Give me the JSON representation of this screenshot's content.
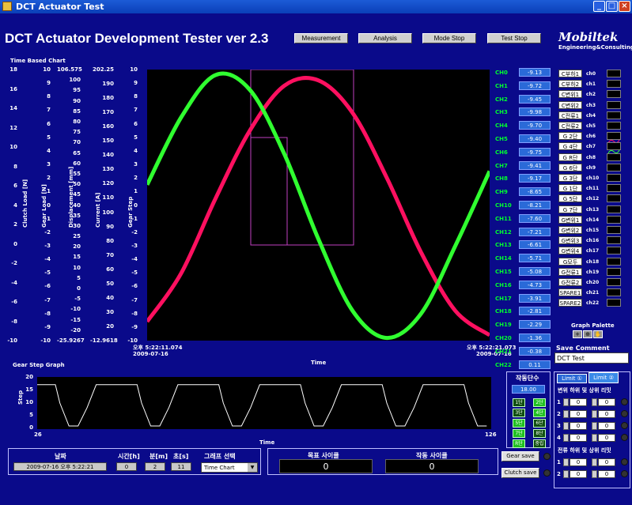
{
  "window": {
    "title": "DCT Actuator Test"
  },
  "header": {
    "app_title": "DCT Actuator Development Tester ver 2.3",
    "buttons": [
      "Measurement",
      "Analysis",
      "Mode Stop",
      "Test Stop"
    ],
    "logo": "Mobiltek",
    "logo_sub": "Engineering&Consulting"
  },
  "time_chart": {
    "section_label": "Time Based Chart",
    "axes": [
      {
        "name": "Clutch Load [N]",
        "ticks": [
          "18",
          "16",
          "14",
          "12",
          "10",
          "8",
          "6",
          "4",
          "2",
          "0",
          "-2",
          "-4",
          "-6",
          "-8",
          "-10"
        ]
      },
      {
        "name": "Gear Load [N]",
        "ticks": [
          "10",
          "9",
          "8",
          "7",
          "6",
          "5",
          "4",
          "3",
          "2",
          "1",
          "0",
          "-1",
          "-2",
          "-3",
          "-4",
          "-5",
          "-6",
          "-7",
          "-8",
          "-9",
          "-10"
        ]
      },
      {
        "name": "Displacement [mm]",
        "ticks": [
          "106.575",
          "100",
          "95",
          "90",
          "85",
          "80",
          "75",
          "70",
          "65",
          "60",
          "55",
          "50",
          "45",
          "40",
          "35",
          "30",
          "25",
          "20",
          "15",
          "10",
          "5",
          "0",
          "-5",
          "-10",
          "-15",
          "-20",
          "-25.9267"
        ]
      },
      {
        "name": "Current [A]",
        "ticks": [
          "202.25",
          "190",
          "180",
          "170",
          "160",
          "150",
          "140",
          "130",
          "120",
          "110",
          "100",
          "90",
          "80",
          "70",
          "60",
          "50",
          "40",
          "30",
          "20",
          "-12.9618"
        ]
      },
      {
        "name": "Gear Step",
        "ticks": [
          "10",
          "9",
          "8",
          "7",
          "6",
          "5",
          "4",
          "3",
          "2",
          "1",
          "0",
          "-1",
          "-2",
          "-3",
          "-4",
          "-5",
          "-6",
          "-7",
          "-8",
          "-9",
          "-10"
        ]
      }
    ],
    "x_start": {
      "time": "오후 5:22:11.074",
      "date": "2009-07-16"
    },
    "x_end": {
      "time": "오후 5:22:21.073",
      "date": "2009-07-16"
    },
    "x_label": "Time"
  },
  "chart_data": [
    {
      "type": "line",
      "title": "Time Based Chart",
      "xlabel": "Time",
      "ylabel": "Gear Step",
      "ylim": [
        -10,
        10
      ],
      "series": [
        {
          "name": "ch6",
          "color": "#ff1060",
          "x": [
            0,
            1,
            2,
            3,
            4,
            5,
            6,
            7,
            8,
            9,
            10
          ],
          "values": [
            -8.6,
            -5.0,
            0.5,
            5.5,
            8.8,
            9.2,
            6.8,
            2.0,
            -3.5,
            -7.8,
            -9.6
          ]
        },
        {
          "name": "ch7",
          "color": "#30ff30",
          "x": [
            0,
            1,
            2,
            3,
            4,
            5,
            6,
            7,
            8,
            9,
            10
          ],
          "values": [
            1.5,
            6.5,
            9.6,
            8.5,
            3.8,
            -2.5,
            -7.8,
            -9.8,
            -8.0,
            -3.0,
            2.5
          ]
        }
      ]
    },
    {
      "type": "line",
      "title": "Gear Step Graph",
      "xlabel": "Time",
      "ylabel": "Step",
      "ylim": [
        0,
        20
      ],
      "xlim": [
        26,
        126
      ],
      "series": [
        {
          "name": "Step",
          "color": "#ffffff",
          "x": [
            26,
            28,
            30,
            31,
            33,
            35,
            37,
            39,
            40,
            42,
            44
          ],
          "values": [
            18,
            18,
            18,
            10,
            0,
            0,
            8,
            18,
            18,
            18,
            18
          ]
        }
      ]
    }
  ],
  "channels": {
    "labels": [
      "CH0",
      "CH1",
      "CH2",
      "CH3",
      "CH4",
      "CH5",
      "CH6",
      "CH7",
      "CH8",
      "CH9",
      "CH10",
      "CH11",
      "CH12",
      "CH13",
      "CH14",
      "CH15",
      "CH16",
      "CH17",
      "CH18",
      "CH19",
      "CH20",
      "CH21",
      "CH22"
    ],
    "values": [
      "-9.13",
      "-9.72",
      "-9.45",
      "-9.98",
      "-9.70",
      "-9.40",
      "-9.75",
      "-9.41",
      "-9.17",
      "-8.65",
      "-8.21",
      "-7.60",
      "-7.21",
      "-6.61",
      "-5.71",
      "-5.08",
      "-4.73",
      "-3.91",
      "-2.81",
      "-2.29",
      "-1.36",
      "-0.38",
      "0.11"
    ]
  },
  "legend": {
    "names": [
      "C부하1",
      "C부하2",
      "C변위1",
      "C변위2",
      "C전류1",
      "C전류2",
      "G 2단",
      "G 4단",
      "G R단",
      "G 6단",
      "G 3단",
      "G 1단",
      "G 5단",
      "G 7단",
      "G변위1",
      "G변위2",
      "G변위3",
      "G변위4",
      "G모두",
      "G전류1",
      "G전류2",
      "SPARE1",
      "SPARE2"
    ],
    "channels": [
      "ch0",
      "ch1",
      "ch2",
      "ch3",
      "ch4",
      "ch5",
      "ch6",
      "ch7",
      "ch8",
      "ch9",
      "ch10",
      "ch11",
      "ch12",
      "ch13",
      "ch14",
      "ch15",
      "ch16",
      "ch17",
      "ch18",
      "ch19",
      "ch20",
      "ch21",
      "ch22"
    ],
    "palette_label": "Graph Palette"
  },
  "save_comment": {
    "label": "Save Comment",
    "value": "DCT Test"
  },
  "gear_step_graph": {
    "label": "Gear Step Graph",
    "y_label": "Step",
    "x_label": "Time",
    "y_ticks": [
      "20",
      "15",
      "10",
      "5",
      "0"
    ],
    "x_min": "26",
    "x_max": "126"
  },
  "step_panel": {
    "title": "작동단수",
    "value": "18.00",
    "buttons": [
      "1단",
      "2단",
      "3단",
      "4단",
      "5단",
      "6단",
      "7단",
      "8단",
      "R단",
      "중립"
    ]
  },
  "limit_panel": {
    "tabs": [
      "Limit ①",
      "Limit ②"
    ],
    "section1": "변위 하위 및 상위 리밋",
    "section2": "전류 하위 및 상위 리밋",
    "rows1": [
      "1",
      "2",
      "3",
      "4"
    ],
    "rows2": [
      "1",
      "2"
    ],
    "field_value": "0"
  },
  "bottom": {
    "date_label": "날짜",
    "date_value": "2009-07-16 오후 5:22:21",
    "hour_label": "시간[h]",
    "hour_value": "0",
    "min_label": "분[m]",
    "min_value": "2",
    "sec_label": "초[s]",
    "sec_value": "11",
    "graph_select_label": "그래프 선택",
    "graph_select_value": "Time Chart",
    "target_cycle_label": "목표 사이클",
    "target_cycle_value": "0",
    "run_cycle_label": "작동 사이클",
    "run_cycle_value": "0",
    "gear_save": "Gear save",
    "clutch_save": "Clutch save"
  }
}
